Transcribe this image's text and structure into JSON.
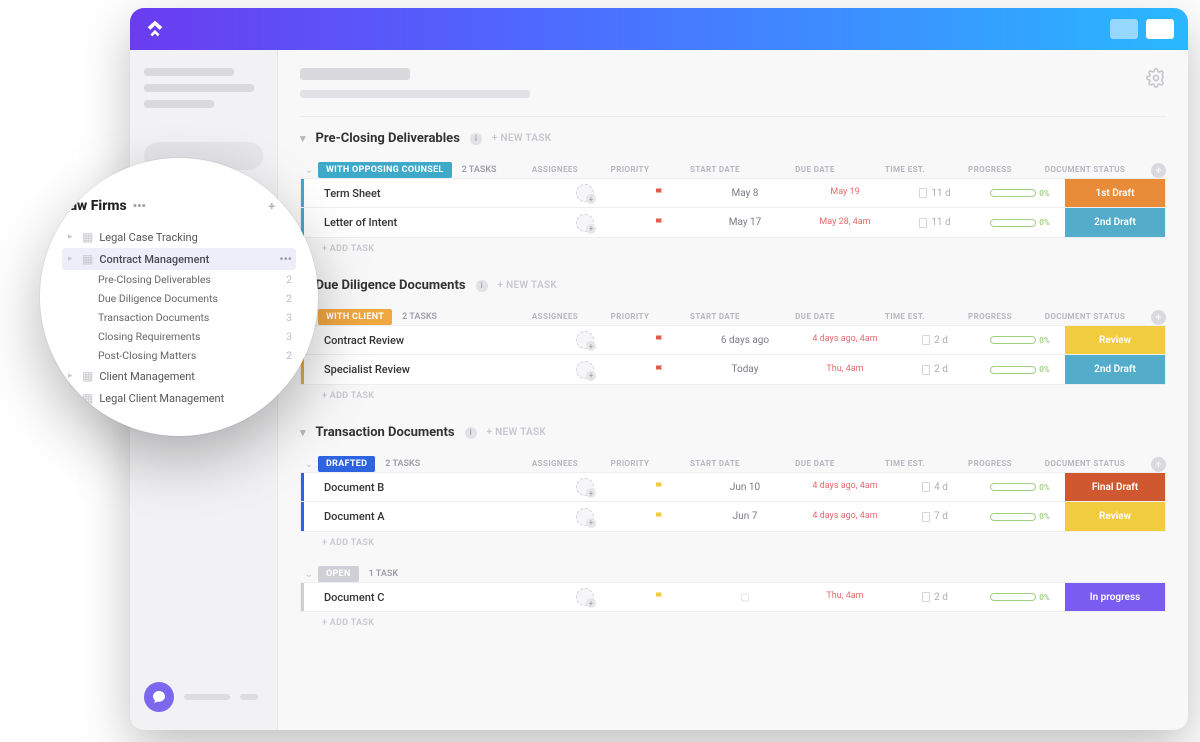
{
  "sidebar_popout": {
    "title": "Law Firms",
    "tree": [
      {
        "label": "Legal Case Tracking"
      },
      {
        "label": "Contract Management",
        "selected": true,
        "children": [
          {
            "label": "Pre-Closing Deliverables",
            "count": 2
          },
          {
            "label": "Due Diligence Documents",
            "count": 2
          },
          {
            "label": "Transaction Documents",
            "count": 3
          },
          {
            "label": "Closing Requirements",
            "count": 3
          },
          {
            "label": "Post-Closing Matters",
            "count": 2
          }
        ]
      },
      {
        "label": "Client Management"
      },
      {
        "label": "Legal Client Management"
      }
    ]
  },
  "columns": {
    "assignees": "ASSIGNEES",
    "priority": "PRIORITY",
    "start": "START DATE",
    "due": "DUE DATE",
    "time": "TIME EST.",
    "progress": "PROGRESS",
    "docstatus": "DOCUMENT STATUS"
  },
  "labels": {
    "new_task": "+ NEW TASK",
    "add_task": "+ ADD TASK"
  },
  "sections": [
    {
      "title": "Pre-Closing Deliverables",
      "groups": [
        {
          "status": "WITH OPPOSING COUNSEL",
          "status_color": "#3fa9c9",
          "task_count": "2 TASKS",
          "tasks": [
            {
              "name": "Term Sheet",
              "flag": "#e05b4a",
              "start": "May 8",
              "due": "May 19",
              "time": "11 d",
              "progress": "0%",
              "doc": "1st Draft",
              "doc_color": "#e98c3a"
            },
            {
              "name": "Letter of Intent",
              "flag": "#e05b4a",
              "start": "May 17",
              "due": "May 28, 4am",
              "time": "11 d",
              "progress": "0%",
              "doc": "2nd Draft",
              "doc_color": "#53acc9"
            }
          ]
        }
      ]
    },
    {
      "title": "Due Diligence Documents",
      "groups": [
        {
          "status": "WITH CLIENT",
          "status_color": "#f0a840",
          "task_count": "2 TASKS",
          "tasks": [
            {
              "name": "Contract Review",
              "flag": "#e05b4a",
              "start": "6 days ago",
              "due": "4 days ago, 4am",
              "time": "2 d",
              "progress": "0%",
              "doc": "Review",
              "doc_color": "#f2cc3f"
            },
            {
              "name": "Specialist Review",
              "flag": "#e05b4a",
              "start": "Today",
              "due": "Thu, 4am",
              "time": "2 d",
              "progress": "0%",
              "doc": "2nd Draft",
              "doc_color": "#53acc9"
            }
          ]
        }
      ]
    },
    {
      "title": "Transaction Documents",
      "groups": [
        {
          "status": "DRAFTED",
          "status_color": "#2f64e0",
          "task_count": "2 TASKS",
          "tasks": [
            {
              "name": "Document B",
              "flag": "#f2cc3f",
              "start": "Jun 10",
              "due": "4 days ago, 4am",
              "time": "4 d",
              "progress": "0%",
              "doc": "Final Draft",
              "doc_color": "#d05830"
            },
            {
              "name": "Document A",
              "flag": "#f2cc3f",
              "start": "Jun 7",
              "due": "4 days ago, 4am",
              "time": "7 d",
              "progress": "0%",
              "doc": "Review",
              "doc_color": "#f2cc3f"
            }
          ]
        },
        {
          "status": "OPEN",
          "status_color": "#cfcfd6",
          "task_count": "1 TASK",
          "tasks": [
            {
              "name": "Document C",
              "flag": "#f2cc3f",
              "start": "",
              "due": "Thu, 4am",
              "time": "2 d",
              "progress": "0%",
              "doc": "In progress",
              "doc_color": "#7a5cf0"
            }
          ]
        }
      ]
    }
  ]
}
